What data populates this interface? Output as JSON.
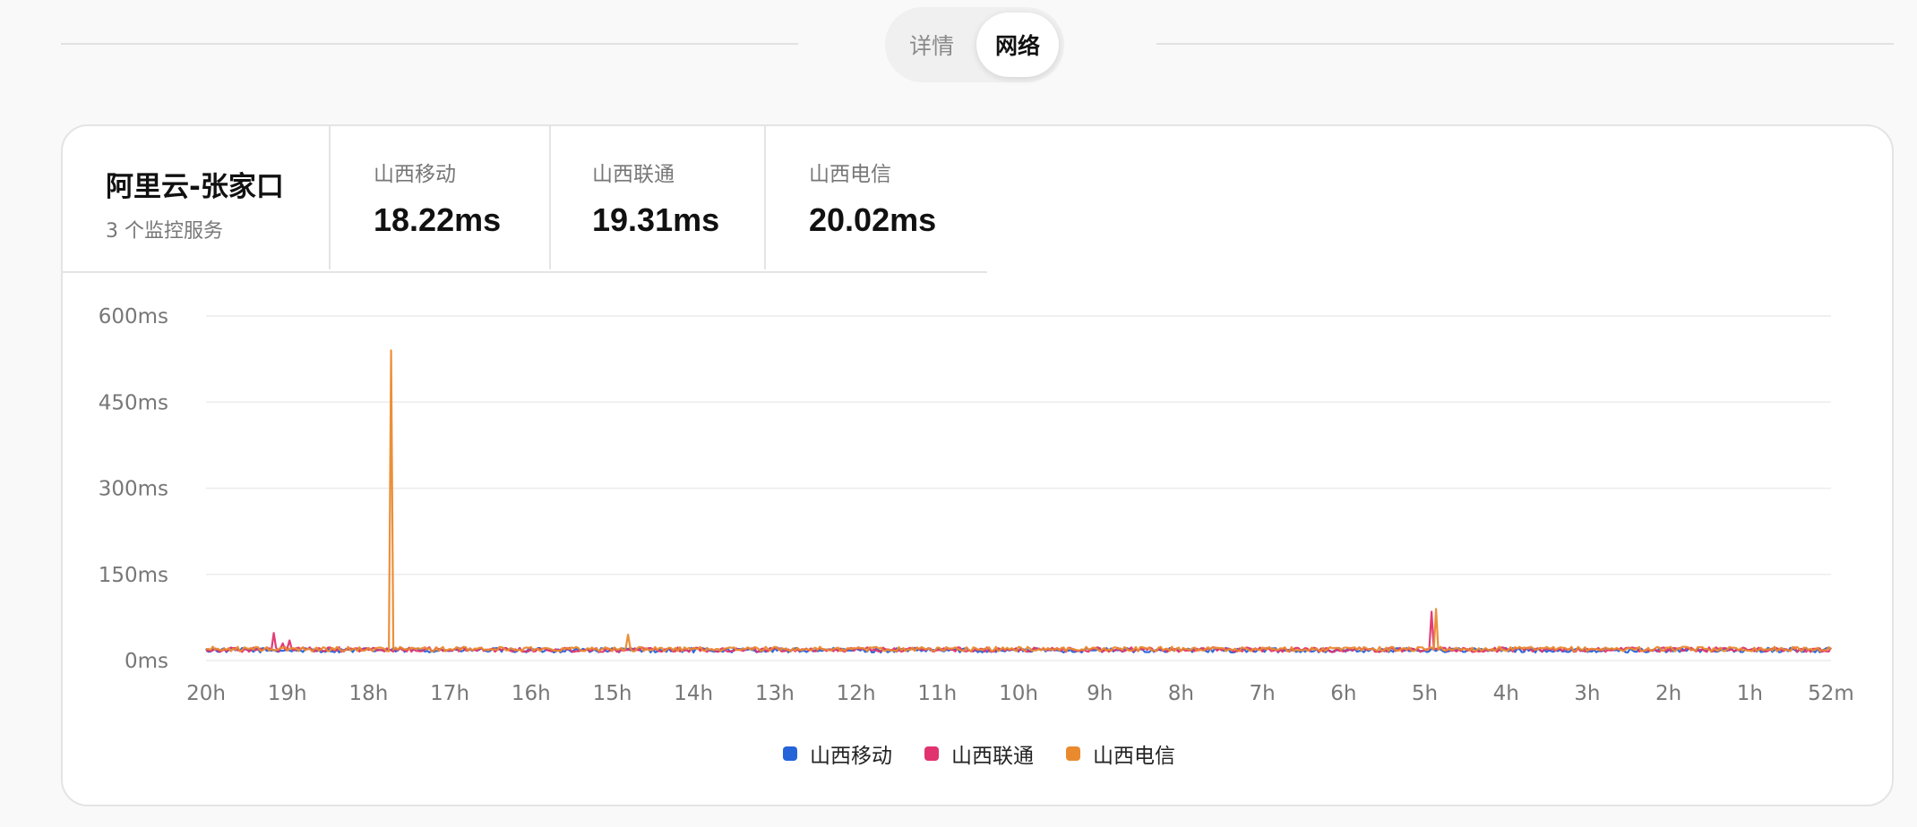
{
  "tabs": [
    {
      "label": "详情",
      "active": false
    },
    {
      "label": "网络",
      "active": true
    }
  ],
  "server": {
    "name": "阿里云-张家口",
    "subtitle": "3 个监控服务"
  },
  "stats": [
    {
      "label": "山西移动",
      "value": "18.22ms"
    },
    {
      "label": "山西联通",
      "value": "19.31ms"
    },
    {
      "label": "山西电信",
      "value": "20.02ms"
    }
  ],
  "colors": {
    "mobile": "#2563d9",
    "unicom": "#e0336f",
    "telecom": "#ea8a2e",
    "grid": "#ececec",
    "tick": "#777777"
  },
  "chart_data": {
    "type": "line",
    "xlabel": "",
    "ylabel": "",
    "ylim": [
      0,
      600
    ],
    "y_ticks": [
      "0ms",
      "150ms",
      "300ms",
      "450ms",
      "600ms"
    ],
    "y_tick_values": [
      0,
      150,
      300,
      450,
      600
    ],
    "x_tick_labels": [
      "20h",
      "19h",
      "18h",
      "17h",
      "16h",
      "15h",
      "14h",
      "13h",
      "12h",
      "11h",
      "10h",
      "9h",
      "8h",
      "7h",
      "6h",
      "5h",
      "4h",
      "3h",
      "2h",
      "1h",
      "52m"
    ],
    "x_range_hours_ago": [
      20.1,
      0.87
    ],
    "grid": true,
    "legend_position": "bottom-center",
    "series": [
      {
        "name": "山西移动",
        "baseline_ms": 18,
        "spikes": []
      },
      {
        "name": "山西联通",
        "baseline_ms": 19,
        "spikes": [
          {
            "hours_ago": 19.3,
            "value": 48
          },
          {
            "hours_ago": 19.2,
            "value": 30
          },
          {
            "hours_ago": 19.1,
            "value": 35
          },
          {
            "hours_ago": 5.6,
            "value": 85
          }
        ]
      },
      {
        "name": "山西电信",
        "baseline_ms": 20,
        "spikes": [
          {
            "hours_ago": 17.9,
            "value": 540
          },
          {
            "hours_ago": 15.1,
            "value": 45
          },
          {
            "hours_ago": 5.55,
            "value": 90
          }
        ]
      }
    ]
  }
}
